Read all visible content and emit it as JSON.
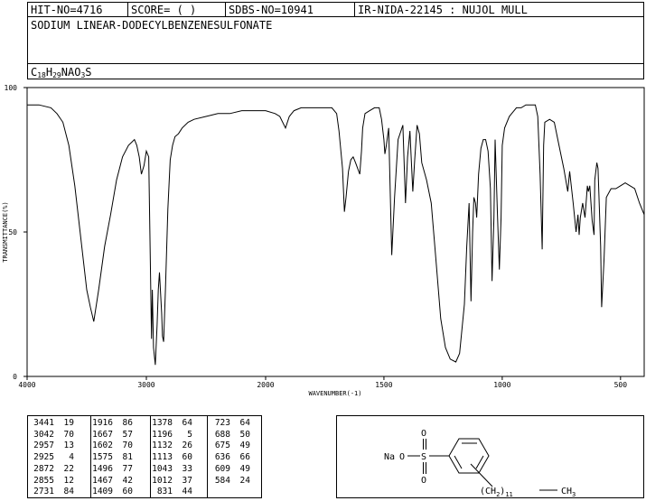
{
  "header": {
    "hit_no": "HIT-NO=4716",
    "score": "SCORE=  (   )",
    "sdbs_no": "SDBS-NO=10941",
    "ir_nida": "IR-NIDA-22145 : NUJOL MULL",
    "compound_name": "SODIUM LINEAR-DODECYLBENZENESULFONATE",
    "formula": {
      "c": "C",
      "c_n": "18",
      "h": "H",
      "h_n": "29",
      "na": "NAO",
      "o_n": "3",
      "s": "S"
    }
  },
  "chart_data": {
    "type": "line",
    "xlabel": "WAVENUMBER(-1)",
    "ylabel": "TRANSMITTANCE(%)",
    "xlim": [
      4000,
      400
    ],
    "ylim": [
      0,
      100
    ],
    "x_ticks": [
      "4000",
      "3000",
      "2000",
      "1500",
      "1000",
      "500"
    ],
    "y_ticks": [
      "100",
      "50",
      "0"
    ],
    "grid": false,
    "series": [
      {
        "x": [
          4000,
          3900,
          3800,
          3750,
          3700,
          3650,
          3600,
          3550,
          3500,
          3470,
          3441,
          3400,
          3350,
          3300,
          3250,
          3200,
          3150,
          3100,
          3080,
          3060,
          3042,
          3020,
          3000,
          2980,
          2957,
          2950,
          2940,
          2925,
          2910,
          2900,
          2890,
          2872,
          2865,
          2855,
          2840,
          2820,
          2800,
          2780,
          2760,
          2731,
          2700,
          2650,
          2600,
          2500,
          2400,
          2300,
          2200,
          2100,
          2050,
          2000,
          1960,
          1940,
          1916,
          1900,
          1880,
          1850,
          1800,
          1780,
          1750,
          1720,
          1700,
          1690,
          1675,
          1667,
          1660,
          1650,
          1640,
          1630,
          1620,
          1602,
          1595,
          1590,
          1580,
          1560,
          1540,
          1520,
          1510,
          1500,
          1496,
          1490,
          1480,
          1467,
          1455,
          1440,
          1420,
          1409,
          1400,
          1390,
          1378,
          1370,
          1360,
          1350,
          1340,
          1320,
          1300,
          1280,
          1260,
          1240,
          1220,
          1196,
          1180,
          1160,
          1150,
          1140,
          1132,
          1125,
          1120,
          1113,
          1108,
          1100,
          1090,
          1080,
          1070,
          1060,
          1050,
          1043,
          1035,
          1030,
          1020,
          1012,
          1005,
          1000,
          990,
          970,
          950,
          940,
          930,
          920,
          900,
          880,
          860,
          850,
          840,
          831,
          825,
          820,
          800,
          780,
          760,
          740,
          723,
          715,
          700,
          688,
          680,
          675,
          670,
          660,
          650,
          640,
          636,
          630,
          620,
          612,
          609,
          600,
          595,
          590,
          584,
          580,
          570,
          560,
          540,
          520,
          500,
          480,
          460,
          440,
          420,
          400
        ],
        "y": [
          94,
          94,
          93,
          91,
          88,
          80,
          66,
          48,
          30,
          24,
          19,
          30,
          45,
          56,
          68,
          76,
          80,
          82,
          80,
          76,
          70,
          73,
          78,
          76,
          13,
          30,
          10,
          4,
          18,
          30,
          36,
          22,
          14,
          12,
          30,
          58,
          75,
          80,
          83,
          84,
          86,
          88,
          89,
          90,
          91,
          91,
          92,
          92,
          92,
          92,
          91,
          90,
          86,
          90,
          92,
          93,
          93,
          93,
          93,
          93,
          91,
          85,
          72,
          57,
          62,
          71,
          75,
          76,
          74,
          70,
          78,
          86,
          91,
          92,
          93,
          93,
          89,
          82,
          77,
          80,
          86,
          42,
          62,
          82,
          87,
          60,
          76,
          85,
          64,
          75,
          87,
          84,
          74,
          68,
          60,
          40,
          20,
          10,
          6,
          5,
          8,
          25,
          45,
          60,
          26,
          50,
          62,
          60,
          55,
          70,
          79,
          82,
          82,
          78,
          65,
          33,
          55,
          82,
          56,
          37,
          55,
          80,
          86,
          90,
          92,
          93,
          93,
          93,
          94,
          94,
          94,
          90,
          70,
          44,
          80,
          88,
          89,
          88,
          80,
          72,
          64,
          71,
          60,
          50,
          56,
          49,
          55,
          60,
          55,
          66,
          64,
          66,
          54,
          49,
          68,
          74,
          72,
          60,
          45,
          24,
          40,
          62,
          65,
          65,
          66,
          67,
          66,
          65,
          60,
          56
        ]
      }
    ]
  },
  "peaks": [
    [
      [
        "3441",
        "19"
      ],
      [
        "3042",
        "70"
      ],
      [
        "2957",
        "13"
      ],
      [
        "2925",
        "4"
      ],
      [
        "2872",
        "22"
      ],
      [
        "2855",
        "12"
      ],
      [
        "2731",
        "84"
      ]
    ],
    [
      [
        "1916",
        "86"
      ],
      [
        "1667",
        "57"
      ],
      [
        "1602",
        "70"
      ],
      [
        "1575",
        "81"
      ],
      [
        "1496",
        "77"
      ],
      [
        "1467",
        "42"
      ],
      [
        "1409",
        "60"
      ]
    ],
    [
      [
        "1378",
        "64"
      ],
      [
        "1196",
        "5"
      ],
      [
        "1132",
        "26"
      ],
      [
        "1113",
        "60"
      ],
      [
        "1043",
        "33"
      ],
      [
        "1012",
        "37"
      ],
      [
        "831",
        "44"
      ]
    ],
    [
      [
        "723",
        "64"
      ],
      [
        "688",
        "50"
      ],
      [
        "675",
        "49"
      ],
      [
        "636",
        "66"
      ],
      [
        "609",
        "49"
      ],
      [
        "584",
        "24"
      ]
    ]
  ],
  "structure": {
    "na_label": "Na",
    "o_label": "O",
    "s_label": "S",
    "chain_prefix": "(CH",
    "chain_2": "2",
    "chain_paren": ")",
    "chain_11": "11",
    "chain_ch": "CH",
    "chain_3": "3"
  }
}
